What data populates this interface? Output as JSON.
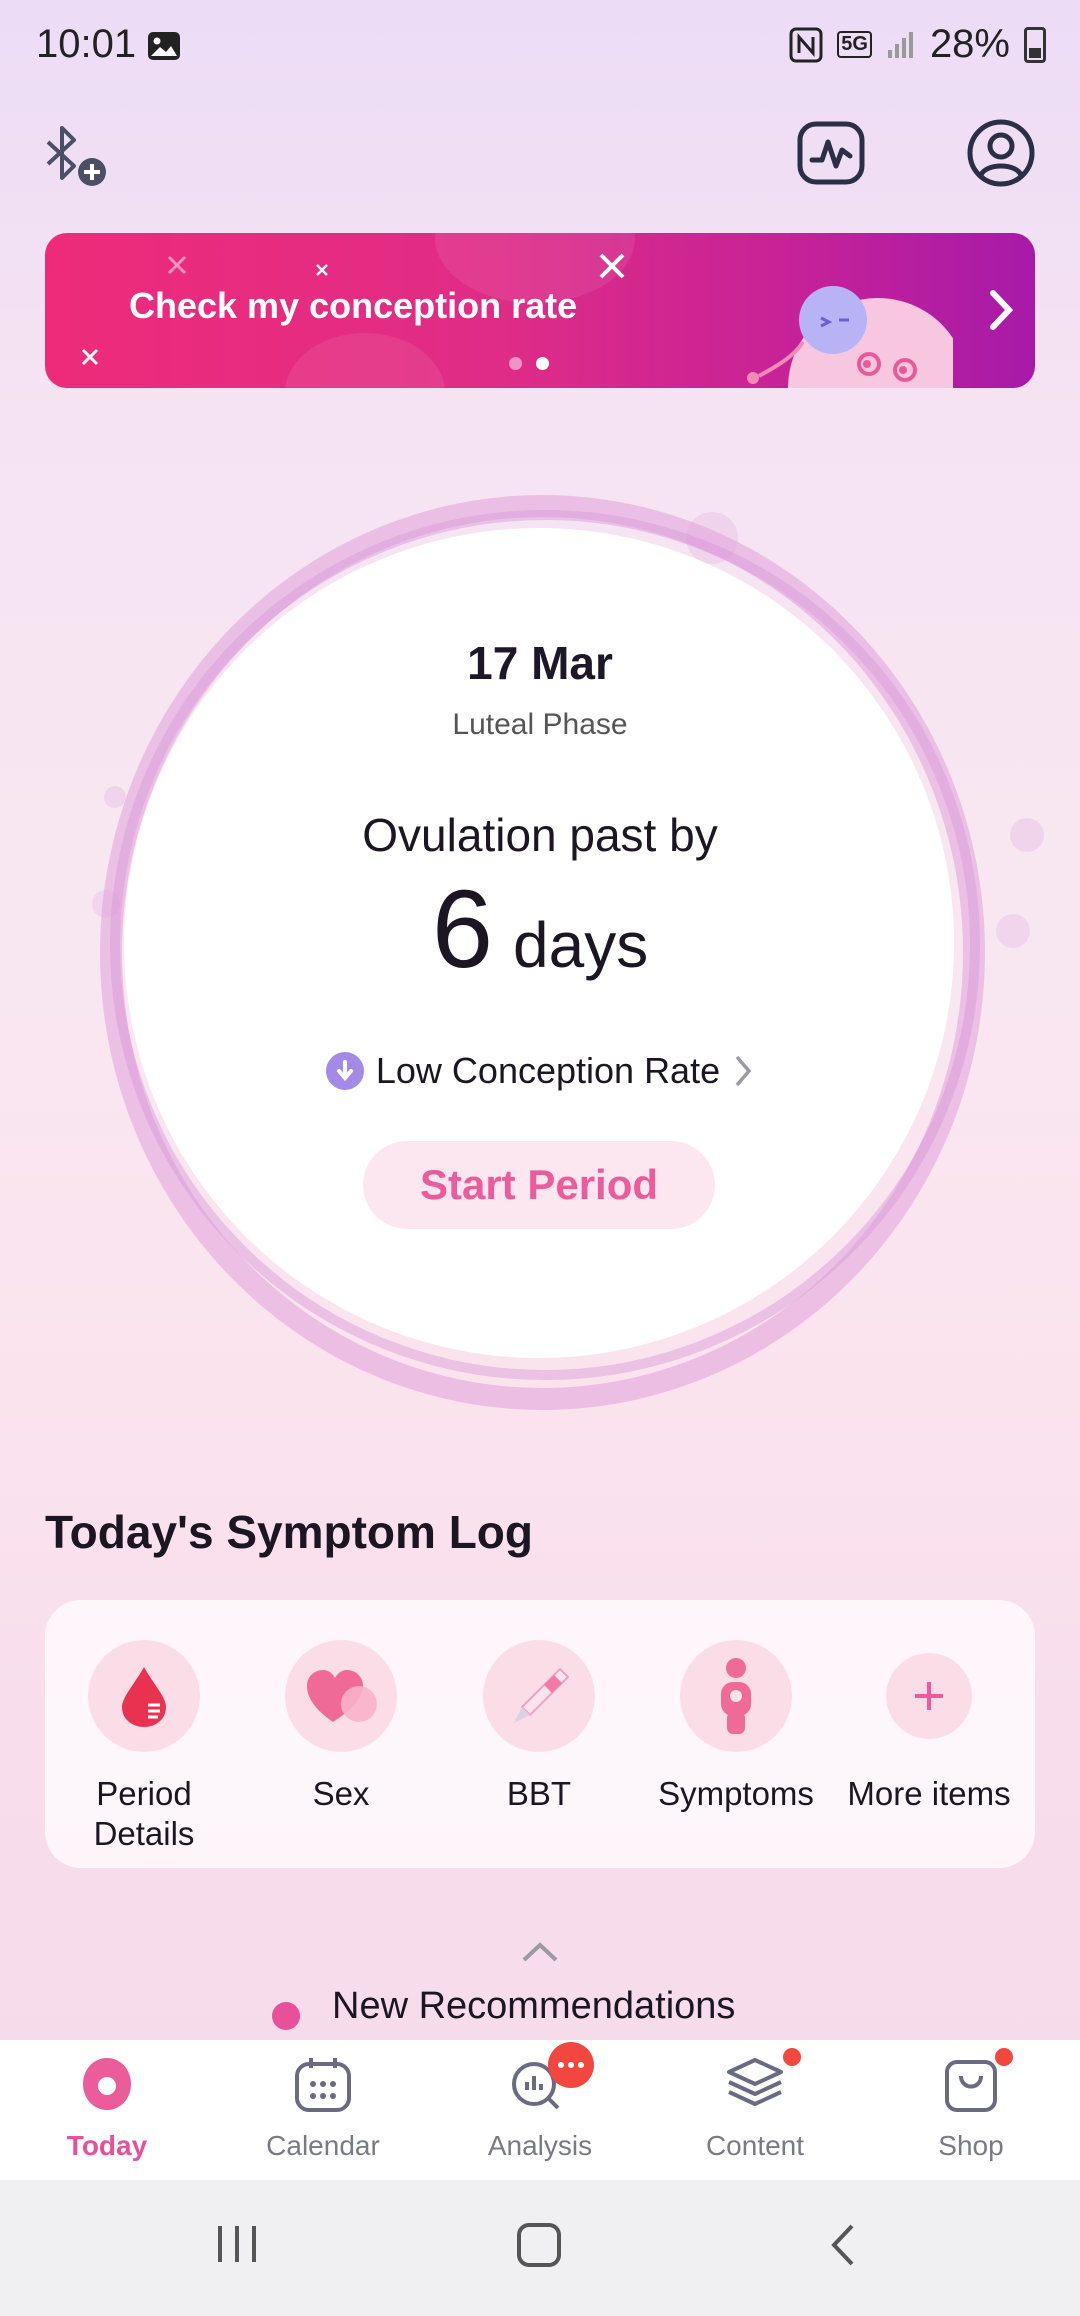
{
  "status_bar": {
    "time": "10:01",
    "network": "5G",
    "battery": "28%"
  },
  "banner": {
    "text": "Check my conception rate",
    "page_count": 2,
    "active_page": 2
  },
  "cycle": {
    "date": "17 Mar",
    "phase": "Luteal Phase",
    "ovulation_text": "Ovulation past by",
    "days_number": "6",
    "days_unit": "days",
    "conception": "Low Conception Rate",
    "start_button": "Start Period"
  },
  "symptom_log": {
    "title": "Today's Symptom Log",
    "items": [
      {
        "label": "Period Details",
        "icon": "blood-drop-icon"
      },
      {
        "label": "Sex",
        "icon": "hearts-icon"
      },
      {
        "label": "BBT",
        "icon": "thermometer-icon"
      },
      {
        "label": "Symptoms",
        "icon": "body-icon"
      },
      {
        "label": "More items",
        "icon": "plus-icon"
      }
    ]
  },
  "recommendations": {
    "label": "New Recommendations"
  },
  "bottom_nav": {
    "items": [
      {
        "label": "Today",
        "icon": "today-icon",
        "active": true
      },
      {
        "label": "Calendar",
        "icon": "calendar-icon"
      },
      {
        "label": "Analysis",
        "icon": "analysis-icon"
      },
      {
        "label": "Content",
        "icon": "layers-icon"
      },
      {
        "label": "Shop",
        "icon": "bag-icon"
      }
    ]
  },
  "colors": {
    "accent": "#e9509a",
    "banner_start": "#ee2b7a",
    "banner_end": "#a71aa8",
    "badge": "#f1473e"
  }
}
